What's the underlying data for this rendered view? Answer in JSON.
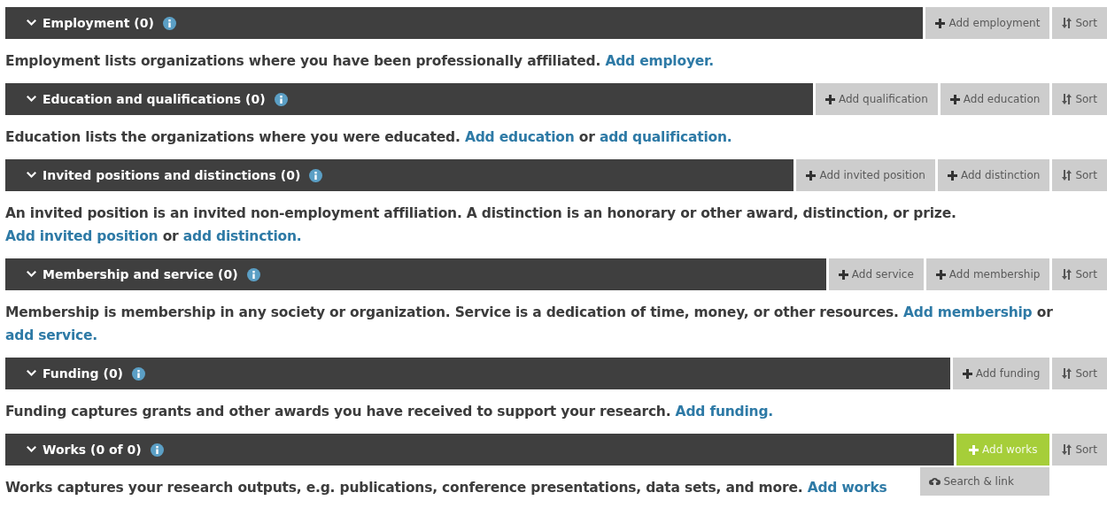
{
  "sections": [
    {
      "title": "Employment (0)",
      "expanded": true,
      "buttons": [
        {
          "kind": "add",
          "label": "Add employment"
        },
        {
          "kind": "sort",
          "label": "Sort"
        }
      ],
      "description": [
        {
          "text": "Employment lists organizations where you have been professionally affiliated. ",
          "link": false
        },
        {
          "text": "Add employer.",
          "link": true
        }
      ]
    },
    {
      "title": "Education and qualifications (0)",
      "expanded": true,
      "buttons": [
        {
          "kind": "add",
          "label": "Add qualification"
        },
        {
          "kind": "add",
          "label": "Add education"
        },
        {
          "kind": "sort",
          "label": "Sort"
        }
      ],
      "description": [
        {
          "text": "Education lists the organizations where you were educated. ",
          "link": false
        },
        {
          "text": "Add education",
          "link": true
        },
        {
          "text": " or ",
          "link": false
        },
        {
          "text": "add qualification.",
          "link": true
        }
      ]
    },
    {
      "title": "Invited positions and distinctions (0)",
      "expanded": true,
      "buttons": [
        {
          "kind": "add",
          "label": "Add invited position"
        },
        {
          "kind": "add",
          "label": "Add distinction"
        },
        {
          "kind": "sort",
          "label": "Sort"
        }
      ],
      "description": [
        {
          "text": "An invited position is an invited non-employment affiliation. A distinction is an honorary or other award, distinction, or prize. ",
          "link": false
        },
        {
          "text": "Add invited position",
          "link": true
        },
        {
          "text": " or ",
          "link": false
        },
        {
          "text": "add distinction.",
          "link": true
        }
      ]
    },
    {
      "title": "Membership and service (0)",
      "expanded": true,
      "buttons": [
        {
          "kind": "add",
          "label": "Add service"
        },
        {
          "kind": "add",
          "label": "Add membership"
        },
        {
          "kind": "sort",
          "label": "Sort"
        }
      ],
      "description": [
        {
          "text": "Membership is membership in any society or organization. Service is a dedication of time, money, or other resources. ",
          "link": false
        },
        {
          "text": "Add membership",
          "link": true
        },
        {
          "text": " or ",
          "link": false
        },
        {
          "text": "add service.",
          "link": true
        }
      ]
    },
    {
      "title": "Funding (0)",
      "expanded": true,
      "buttons": [
        {
          "kind": "add",
          "label": "Add funding"
        },
        {
          "kind": "sort",
          "label": "Sort"
        }
      ],
      "description": [
        {
          "text": "Funding captures grants and other awards you have received to support your research. ",
          "link": false
        },
        {
          "text": "Add funding.",
          "link": true
        }
      ]
    },
    {
      "title": "Works (0 of 0)",
      "expanded": true,
      "buttons": [
        {
          "kind": "primary",
          "label": "Add works",
          "menu": [
            {
              "label": "Search & link"
            }
          ]
        },
        {
          "kind": "sort",
          "label": "Sort"
        }
      ],
      "description": [
        {
          "text": "Works captures your research outputs, e.g. publications, conference presentations, data sets, and more. ",
          "link": false
        },
        {
          "text": "Add works",
          "link": true
        }
      ]
    }
  ]
}
